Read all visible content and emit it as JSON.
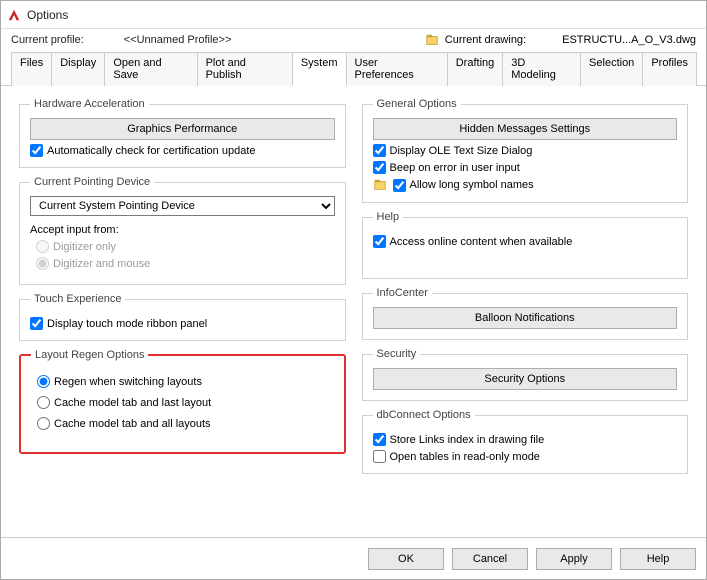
{
  "window": {
    "title": "Options"
  },
  "profile": {
    "label": "Current profile:",
    "value": "<<Unnamed Profile>>",
    "drawing_label": "Current drawing:",
    "drawing_value": "ESTRUCTU...A_O_V3.dwg"
  },
  "tabs": [
    "Files",
    "Display",
    "Open and Save",
    "Plot and Publish",
    "System",
    "User Preferences",
    "Drafting",
    "3D Modeling",
    "Selection",
    "Profiles"
  ],
  "active_tab": "System",
  "left": {
    "hardware": {
      "legend": "Hardware Acceleration",
      "button": "Graphics Performance",
      "auto_check": "Automatically check for certification update"
    },
    "pointing": {
      "legend": "Current Pointing Device",
      "combo": "Current System Pointing Device",
      "accept_label": "Accept input from:",
      "r1": "Digitizer only",
      "r2": "Digitizer and mouse"
    },
    "touch": {
      "legend": "Touch Experience",
      "chk": "Display touch mode ribbon panel"
    },
    "layout": {
      "legend": "Layout Regen Options",
      "r1": "Regen when switching layouts",
      "r2": "Cache model tab and last layout",
      "r3": "Cache model tab and all layouts"
    }
  },
  "right": {
    "general": {
      "legend": "General Options",
      "button": "Hidden Messages Settings",
      "c1": "Display OLE Text Size Dialog",
      "c2": "Beep on error in user input",
      "c3": "Allow long symbol names"
    },
    "help": {
      "legend": "Help",
      "c1": "Access online content when available"
    },
    "info": {
      "legend": "InfoCenter",
      "button": "Balloon Notifications"
    },
    "security": {
      "legend": "Security",
      "button": "Security Options"
    },
    "dbconnect": {
      "legend": "dbConnect Options",
      "c1": "Store Links index in drawing file",
      "c2": "Open tables in read-only mode"
    }
  },
  "footer": {
    "ok": "OK",
    "cancel": "Cancel",
    "apply": "Apply",
    "help": "Help"
  }
}
